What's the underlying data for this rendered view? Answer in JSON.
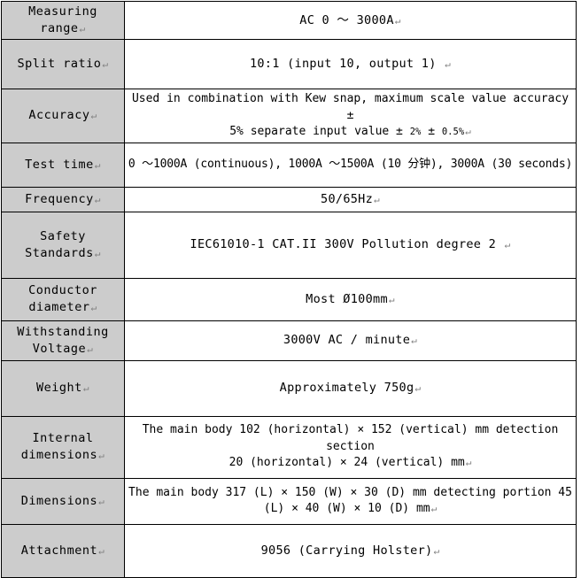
{
  "table": {
    "pilcrow": "↵",
    "rows": [
      {
        "label": "Measuring range",
        "value": "AC 0 ～ 3000A",
        "style": "center"
      },
      {
        "label": "Split ratio",
        "value": "10:1 (input 10, output 1)",
        "style": "center"
      },
      {
        "label": "Accuracy",
        "value_line1": "Used in combination with Kew snap, maximum scale value accuracy ±",
        "value_line2_prefix": "5% separate input value ± ",
        "value_line2_small1": "2%",
        "value_line2_mid": " ± ",
        "value_line2_small2": "0.5%",
        "style": "wide"
      },
      {
        "label": "Test time",
        "value": "0 ～1000A (continuous), 1000A ～1500A (10 分钟), 3000A (30 seconds)",
        "style": "wide-tight"
      },
      {
        "label": "Frequency",
        "value": "50/65Hz",
        "style": "center"
      },
      {
        "label": "Safety Standards",
        "label_line1": "Safety",
        "label_line2": "Standards",
        "value": "IEC61010-1 CAT.II 300V Pollution degree 2 ",
        "style": "center"
      },
      {
        "label": "Conductor diameter",
        "label_line1": "Conductor",
        "label_line2": "diameter",
        "value": "Most Ø100mm",
        "style": "center"
      },
      {
        "label": "Withstanding Voltage",
        "label_line1": "Withstanding",
        "label_line2": "Voltage",
        "value": "3000V AC / minute",
        "style": "center"
      },
      {
        "label": "Weight",
        "value": "Approximately 750g",
        "style": "center"
      },
      {
        "label": "Internal dimensions",
        "label_line1": "Internal",
        "label_line2": "dimensions",
        "value_line1": "The main body 102 (horizontal) × 152 (vertical) mm detection section",
        "value_line2": "20 (horizontal) × 24 (vertical) mm",
        "style": "wide"
      },
      {
        "label": "Dimensions",
        "value_line1": "The main body 317 (L) × 150 (W) × 30 (D) mm detecting portion 45",
        "value_line2": "(L) × 40 (W) × 10 (D) mm",
        "style": "wide"
      },
      {
        "label": "Attachment",
        "value": "9056 (Carrying Holster)",
        "style": "center"
      }
    ]
  },
  "colors": {
    "label_background": "#cccccc",
    "value_background": "#ffffff",
    "border": "#000000",
    "text": "#000000",
    "pilcrow": "#808080"
  }
}
